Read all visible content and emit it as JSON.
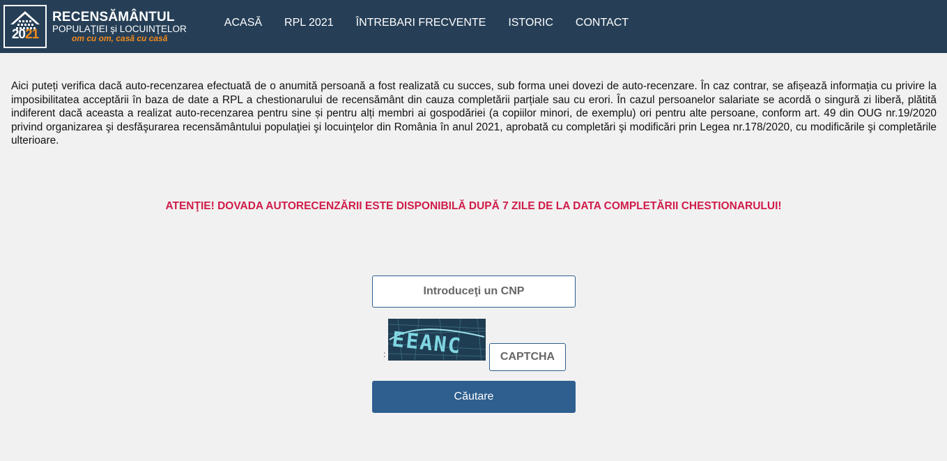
{
  "header": {
    "logo": {
      "title": "RECENSĂMÂNTUL",
      "subtitle": "POPULAŢIEI şi LOCUINŢELOR",
      "slogan": "om cu om, casă cu casă",
      "year_a": "20",
      "year_b": "21",
      "accent": "#f18a1b"
    },
    "nav": [
      "ACASĂ",
      "RPL 2021",
      "ÎNTREBARI FRECVENTE",
      "ISTORIC",
      "CONTACT"
    ]
  },
  "intro": "Aici puteți verifica dacă auto-recenzarea efectuată de o anumită persoană a fost realizată cu succes, sub forma unei dovezi de auto-recenzare. În caz contrar, se afișează informația cu privire la imposibilitatea acceptării în baza de date a RPL a chestionarului de recensământ din cauza completării parțiale sau cu erori. În cazul persoanelor salariate se acordă o singură zi liberă, plătită indiferent dacă aceasta a realizat auto-recenzarea pentru sine și pentru alți membri ai gospodăriei (a copiilor minori, de exemplu) ori pentru alte persoane, conform art. 49 din OUG nr.19/2020 privind organizarea şi desfăşurarea recensământului populaţiei şi locuinţelor din România în anul 2021, aprobată cu completări şi modificări prin Legea nr.178/2020, cu modificările şi completările ulterioare.",
  "warning": "ATENŢIE! DOVADA AUTORECENZĂRII ESTE DISPONIBILĂ DUPĂ 7 ZILE DE LA DATA COMPLETĂRII CHESTIONARULUI!",
  "form": {
    "cnp_placeholder": "Introduceţi un CNP",
    "captcha_text": "EEANC",
    "captcha_prefix": ":",
    "captcha_placeholder": "CAPTCHA",
    "search_label": "Căutare"
  },
  "colors": {
    "header_bg": "#263f57",
    "warning": "#d01c4a",
    "button": "#2e5f8f"
  }
}
